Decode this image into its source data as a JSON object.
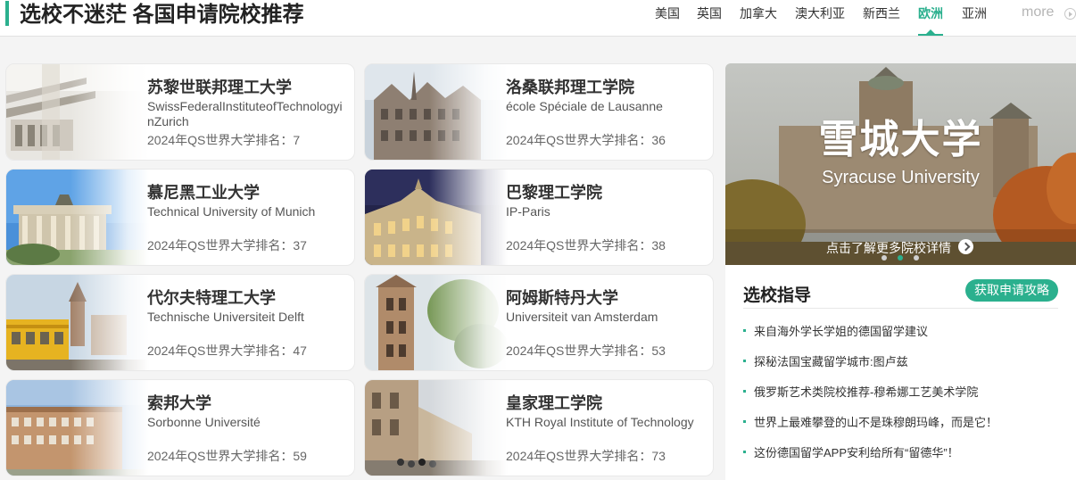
{
  "header": {
    "title": "选校不迷茫 各国申请院校推荐",
    "tabs": [
      {
        "label": "美国",
        "active": false
      },
      {
        "label": "英国",
        "active": false
      },
      {
        "label": "加拿大",
        "active": false
      },
      {
        "label": "澳大利亚",
        "active": false
      },
      {
        "label": "新西兰",
        "active": false
      },
      {
        "label": "欧洲",
        "active": true
      },
      {
        "label": "亚洲",
        "active": false
      }
    ],
    "more_label": "more"
  },
  "schools": [
    {
      "name": "苏黎世联邦理工大学",
      "en": "SwissFederalInstituteofTechnologyinZurich",
      "rank": "2024年QS世界大学排名：7"
    },
    {
      "name": "洛桑联邦理工学院",
      "en": "école Spéciale de Lausanne",
      "rank": "2024年QS世界大学排名：36"
    },
    {
      "name": "慕尼黑工业大学",
      "en": "Technical University of Munich",
      "rank": "2024年QS世界大学排名：37"
    },
    {
      "name": "巴黎理工学院",
      "en": "IP-Paris",
      "rank": "2024年QS世界大学排名：38"
    },
    {
      "name": "代尔夫特理工大学",
      "en": "Technische Universiteit Delft",
      "rank": "2024年QS世界大学排名：47"
    },
    {
      "name": "阿姆斯特丹大学",
      "en": "Universiteit van Amsterdam",
      "rank": "2024年QS世界大学排名：53"
    },
    {
      "name": "索邦大学",
      "en": "Sorbonne Université",
      "rank": "2024年QS世界大学排名：59"
    },
    {
      "name": "皇家理工学院",
      "en": "KTH Royal Institute of Technology",
      "rank": "2024年QS世界大学排名：73"
    }
  ],
  "banner": {
    "title": "雪城大学",
    "subtitle": "Syracuse University",
    "link_label": "点击了解更多院校详情",
    "slide_count": 3,
    "active_slide": 2
  },
  "guide": {
    "title": "选校指导",
    "button_label": "获取申请攻略",
    "articles": [
      "来自海外学长学姐的德国留学建议",
      "探秘法国宝藏留学城市:图卢兹",
      "俄罗斯艺术类院校推荐-穆希娜工艺美术学院",
      "世界上最难攀登的山不是珠穆朗玛峰，而是它！",
      "这份德国留学APP安利给所有“留德华”！"
    ]
  },
  "colors": {
    "accent": "#2bb08e",
    "text": "#333333",
    "muted": "#666666",
    "background": "#f4f4f4"
  }
}
